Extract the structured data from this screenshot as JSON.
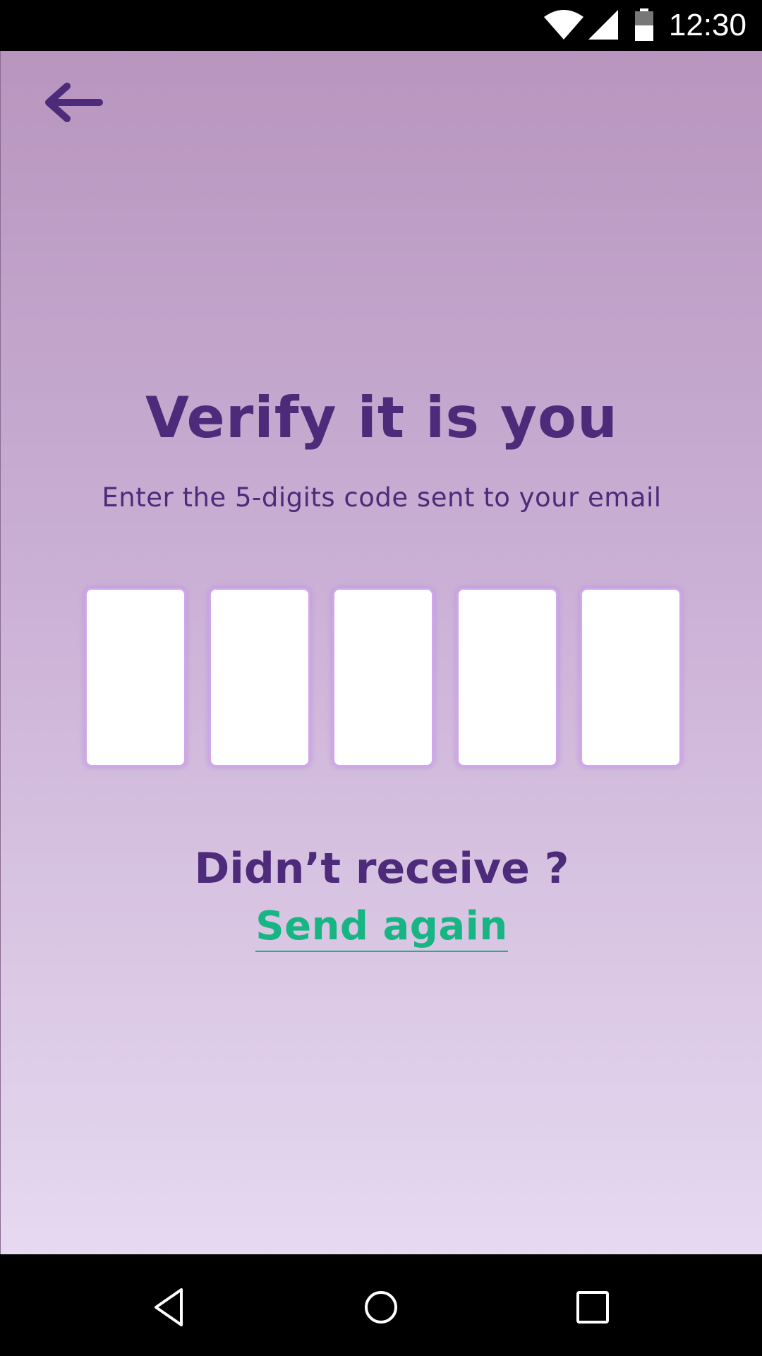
{
  "status_bar": {
    "time": "12:30",
    "icons": [
      "wifi-icon",
      "cell-signal-icon",
      "battery-icon"
    ]
  },
  "header": {
    "back_icon": "arrow-left-icon"
  },
  "verify": {
    "title": "Verify it is you",
    "subtitle": "Enter the 5-digits code sent to your email",
    "code_digits": [
      "",
      "",
      "",
      "",
      ""
    ]
  },
  "resend": {
    "prompt": "Didn’t receive ?",
    "link_label": "Send again"
  },
  "colors": {
    "primary": "#4e2b7a",
    "accent": "#17b584",
    "gradient_top": "#b895be",
    "gradient_bottom": "#e6d9f0",
    "box_border": "#cfa8ea"
  },
  "nav_bar": {
    "icons": [
      "nav-back-icon",
      "nav-home-icon",
      "nav-recents-icon"
    ]
  }
}
